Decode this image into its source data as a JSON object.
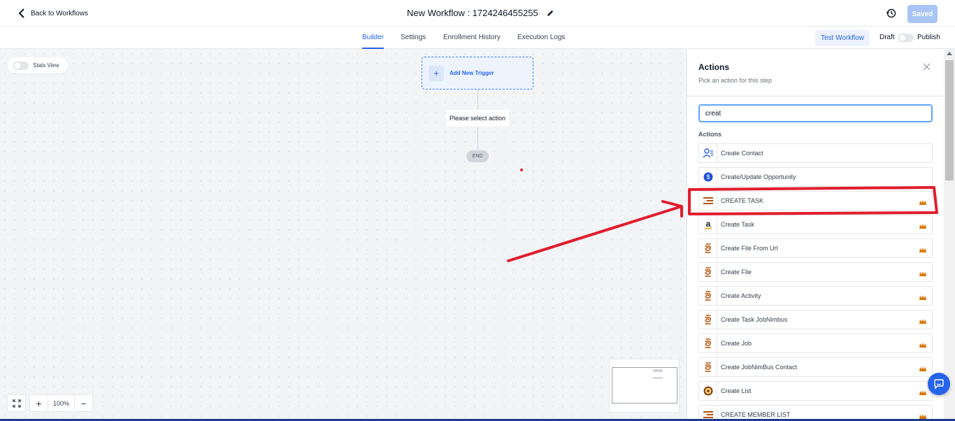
{
  "header": {
    "back_label": "Back to Workflows",
    "workflow_title": "New Workflow : 1724246455255",
    "saved_label": "Saved"
  },
  "tabs": [
    {
      "label": "Builder",
      "active": true
    },
    {
      "label": "Settings",
      "active": false
    },
    {
      "label": "Enrollment History",
      "active": false
    },
    {
      "label": "Execution Logs",
      "active": false
    }
  ],
  "toolbar": {
    "test_workflow_label": "Test Workflow",
    "draft_label": "Draft",
    "publish_label": "Publish",
    "publish_enabled": false
  },
  "canvas": {
    "stats_view_label": "Stats View",
    "stats_view_enabled": false,
    "trigger_label": "Add New Trigger",
    "select_action_label": "Please select action",
    "end_label": "END",
    "zoom_label": "100%"
  },
  "panel": {
    "title": "Actions",
    "subtitle": "Pick an action for this step",
    "search_value": "creat",
    "section_label": "Actions",
    "items": [
      {
        "label": "Create Contact",
        "icon": "contact-icon",
        "premium": false
      },
      {
        "label": "Create/Update Opportunity",
        "icon": "dollar-icon",
        "premium": false
      },
      {
        "label": "CREATE TASK",
        "icon": "stack-icon",
        "premium": true
      },
      {
        "label": "Create Task",
        "icon": "amazon-icon",
        "premium": true
      },
      {
        "label": "Create File From Url",
        "icon": "jobnimbus-icon",
        "premium": true
      },
      {
        "label": "Create File",
        "icon": "jobnimbus-icon",
        "premium": true
      },
      {
        "label": "Create Activity",
        "icon": "jobnimbus-icon",
        "premium": true
      },
      {
        "label": "Create Task JobNimbus",
        "icon": "jobnimbus-icon",
        "premium": true
      },
      {
        "label": "Create Job",
        "icon": "jobnimbus-icon",
        "premium": true
      },
      {
        "label": "Create JobNimBus Contact",
        "icon": "jobnimbus-icon",
        "premium": true
      },
      {
        "label": "Create List",
        "icon": "target-icon",
        "premium": true
      },
      {
        "label": "CREATE MEMBER LIST",
        "icon": "stack-icon",
        "premium": true
      }
    ]
  },
  "colors": {
    "accent": "#2563eb",
    "annotation": "#e11d2e",
    "crown": "#d97706"
  }
}
